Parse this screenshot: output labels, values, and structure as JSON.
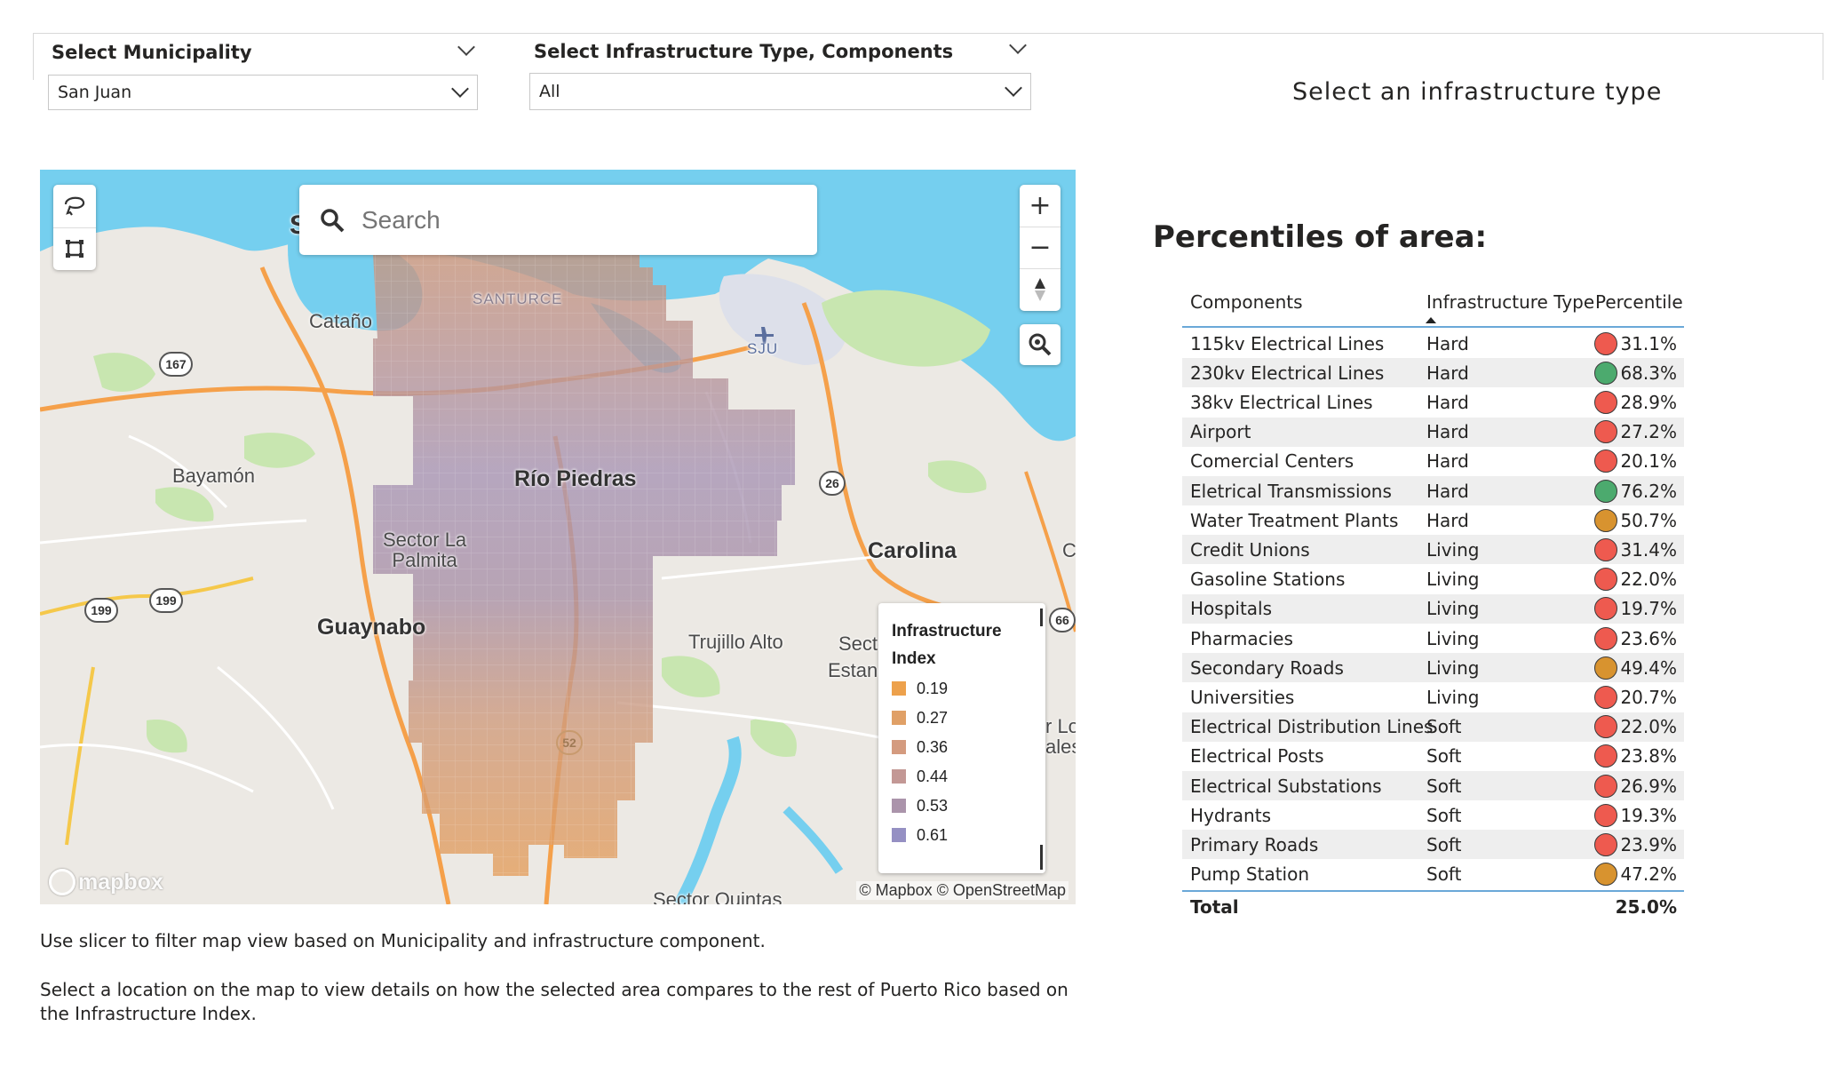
{
  "slicers": {
    "municipality": {
      "title": "Select Municipality",
      "value": "San Juan"
    },
    "infrastructure": {
      "title": "Select Infrastructure Type, Components",
      "value": "All"
    }
  },
  "infra_prompt": "Select an infrastructure type",
  "map": {
    "search_placeholder": "Search",
    "labels": {
      "santurce": "SANTURCE",
      "catano": "Cataño",
      "sju": "SJU",
      "bayamon": "Bayamón",
      "rio_piedras": "Río Piedras",
      "carolina": "Carolina",
      "sector_la_palmita": "Sector La\nPalmita",
      "guaynabo": "Guaynabo",
      "trujillo_alto": "Trujillo Alto",
      "secto": "Secto",
      "estanc": "Estanc",
      "sector_quintas": "Sector Quintas",
      "s_partial": "S",
      "c_partial": "C",
      "r_lo": "r Lo",
      "ales": "ales"
    },
    "shields": {
      "r167": "167",
      "r26": "26",
      "r199a": "199",
      "r199b": "199",
      "r66": "66",
      "r52": "52"
    },
    "legend": {
      "title": "Infrastructure Index",
      "items": [
        {
          "label": "0.19",
          "color": "#eda14c"
        },
        {
          "label": "0.27",
          "color": "#e0a067"
        },
        {
          "label": "0.36",
          "color": "#d49b7f"
        },
        {
          "label": "0.44",
          "color": "#c39895"
        },
        {
          "label": "0.53",
          "color": "#ab94ab"
        },
        {
          "label": "0.61",
          "color": "#9590c3"
        }
      ]
    },
    "attribution": "© Mapbox © OpenStreetMap",
    "logo": "mapbox"
  },
  "instructions": {
    "line1": "Use slicer to filter map view based on Municipality and infrastructure component.",
    "line2": "Select a location on the map to view details on how the selected area compares to the rest of Puerto Rico based on the Infrastructure Index."
  },
  "table": {
    "title": "Percentiles of area:",
    "headers": {
      "components": "Components",
      "type": "Infrastructure Type",
      "percentile": "Percentile"
    },
    "rows": [
      {
        "component": "115kv Electrical Lines",
        "type": "Hard",
        "percentile": "31.1%",
        "status": "red"
      },
      {
        "component": "230kv Electrical Lines",
        "type": "Hard",
        "percentile": "68.3%",
        "status": "green"
      },
      {
        "component": "38kv Electrical Lines",
        "type": "Hard",
        "percentile": "28.9%",
        "status": "red"
      },
      {
        "component": "Airport",
        "type": "Hard",
        "percentile": "27.2%",
        "status": "red"
      },
      {
        "component": "Comercial Centers",
        "type": "Hard",
        "percentile": "20.1%",
        "status": "red"
      },
      {
        "component": "Eletrical Transmissions",
        "type": "Hard",
        "percentile": "76.2%",
        "status": "green"
      },
      {
        "component": "Water Treatment Plants",
        "type": "Hard",
        "percentile": "50.7%",
        "status": "amber"
      },
      {
        "component": "Credit Unions",
        "type": "Living",
        "percentile": "31.4%",
        "status": "red"
      },
      {
        "component": "Gasoline Stations",
        "type": "Living",
        "percentile": "22.0%",
        "status": "red"
      },
      {
        "component": "Hospitals",
        "type": "Living",
        "percentile": "19.7%",
        "status": "red"
      },
      {
        "component": "Pharmacies",
        "type": "Living",
        "percentile": "23.6%",
        "status": "red"
      },
      {
        "component": "Secondary Roads",
        "type": "Living",
        "percentile": "49.4%",
        "status": "amber"
      },
      {
        "component": "Universities",
        "type": "Living",
        "percentile": "20.7%",
        "status": "red"
      },
      {
        "component": "Electrical Distribution Lines",
        "type": "Soft",
        "percentile": "22.0%",
        "status": "red"
      },
      {
        "component": "Electrical Posts",
        "type": "Soft",
        "percentile": "23.8%",
        "status": "red"
      },
      {
        "component": "Electrical Substations",
        "type": "Soft",
        "percentile": "26.9%",
        "status": "red"
      },
      {
        "component": "Hydrants",
        "type": "Soft",
        "percentile": "19.3%",
        "status": "red"
      },
      {
        "component": "Primary Roads",
        "type": "Soft",
        "percentile": "23.9%",
        "status": "red"
      },
      {
        "component": "Pump Station",
        "type": "Soft",
        "percentile": "47.2%",
        "status": "amber"
      }
    ],
    "total_label": "Total",
    "total_value": "25.0%",
    "status_colors": {
      "red": "#ee5a4f",
      "green": "#4caa6e",
      "amber": "#d8932f"
    }
  }
}
